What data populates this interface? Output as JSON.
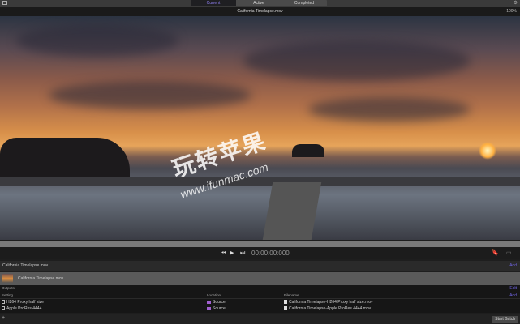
{
  "tabs": [
    {
      "label": "Current",
      "selected": true
    },
    {
      "label": "Active"
    },
    {
      "label": "Completed"
    }
  ],
  "viewer": {
    "title": "California Timelapse.mov",
    "zoom": "100%",
    "timecode": "00:00:00:000"
  },
  "watermark": {
    "text": "玩转苹果",
    "url": "www.ifunmac.com"
  },
  "clip": {
    "header": "California Timelapse.mov",
    "header_action": "Add",
    "name": "California Timelapse.mov"
  },
  "outputs": {
    "title": "Outputs",
    "edit": "Edit",
    "add": "Add",
    "columns": [
      "Setting",
      "Location",
      "Filename"
    ],
    "rows": [
      {
        "setting": "H264 Proxy half size",
        "location": "Source",
        "filename": "California Timelapse-H264 Proxy half size.mov"
      },
      {
        "setting": "Apple ProRes 4444",
        "location": "Source",
        "filename": "California Timelapse-Apple ProRes 4444.mov"
      }
    ]
  },
  "footer": {
    "add": "+",
    "start": "Start Batch"
  },
  "colors": {
    "accent": "#6f63e0",
    "location_folder": "#a060d0"
  }
}
